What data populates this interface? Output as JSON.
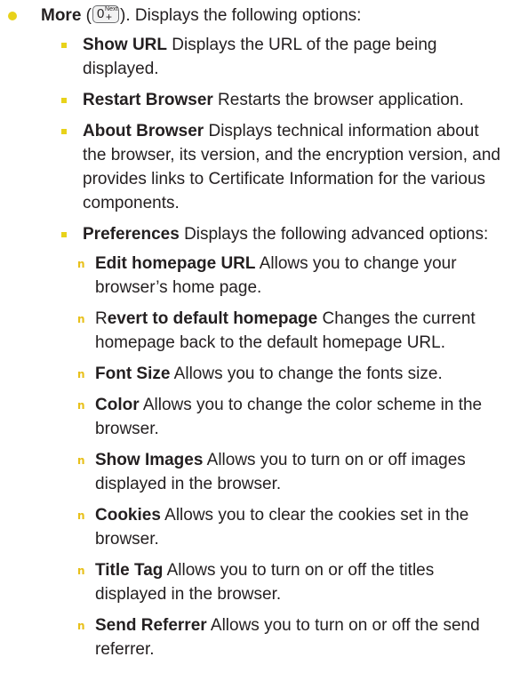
{
  "top": {
    "bold": "More",
    "open_paren": " (",
    "key": {
      "main": "0",
      "sup": "Next",
      "sub": "+"
    },
    "rest": "). Displays the following options:"
  },
  "level2": [
    {
      "bold": "Show URL",
      "text": " Displays the URL of the page being displayed."
    },
    {
      "bold": "Restart Browser",
      "text": " Restarts the browser application."
    },
    {
      "bold": "About Browser",
      "text": " Displays technical information about the browser, its version, and the encryption version, and provides links to Certificate Information for the various components."
    },
    {
      "bold": "Preferences",
      "text": " Displays the following advanced options:"
    }
  ],
  "level3": [
    {
      "pre": "",
      "bold": "Edit homepage URL",
      "text": " Allows you to change your browser’s home page."
    },
    {
      "pre": "R",
      "bold": "evert to default homepage",
      "text": " Changes the current homepage back to the default homepage URL."
    },
    {
      "pre": "",
      "bold": "Font Size",
      "text": " Allows you to change the fonts size."
    },
    {
      "pre": "",
      "bold": "Color",
      "text": " Allows you to change the color scheme in the browser."
    },
    {
      "pre": "",
      "bold": "Show Images",
      "text": " Allows you to turn on or off images displayed in the browser."
    },
    {
      "pre": "",
      "bold": "Cookies",
      "text": " Allows you to clear the cookies set in the browser."
    },
    {
      "pre": "",
      "bold": "Title Tag",
      "text": " Allows you to turn on or off the titles displayed in the browser."
    },
    {
      "pre": "",
      "bold": "Send Referrer",
      "text": " Allows you to turn on or off the send referrer."
    }
  ],
  "markers": {
    "level3": "n"
  },
  "colors": {
    "bullet": "#e8d21a",
    "text": "#231f20"
  }
}
